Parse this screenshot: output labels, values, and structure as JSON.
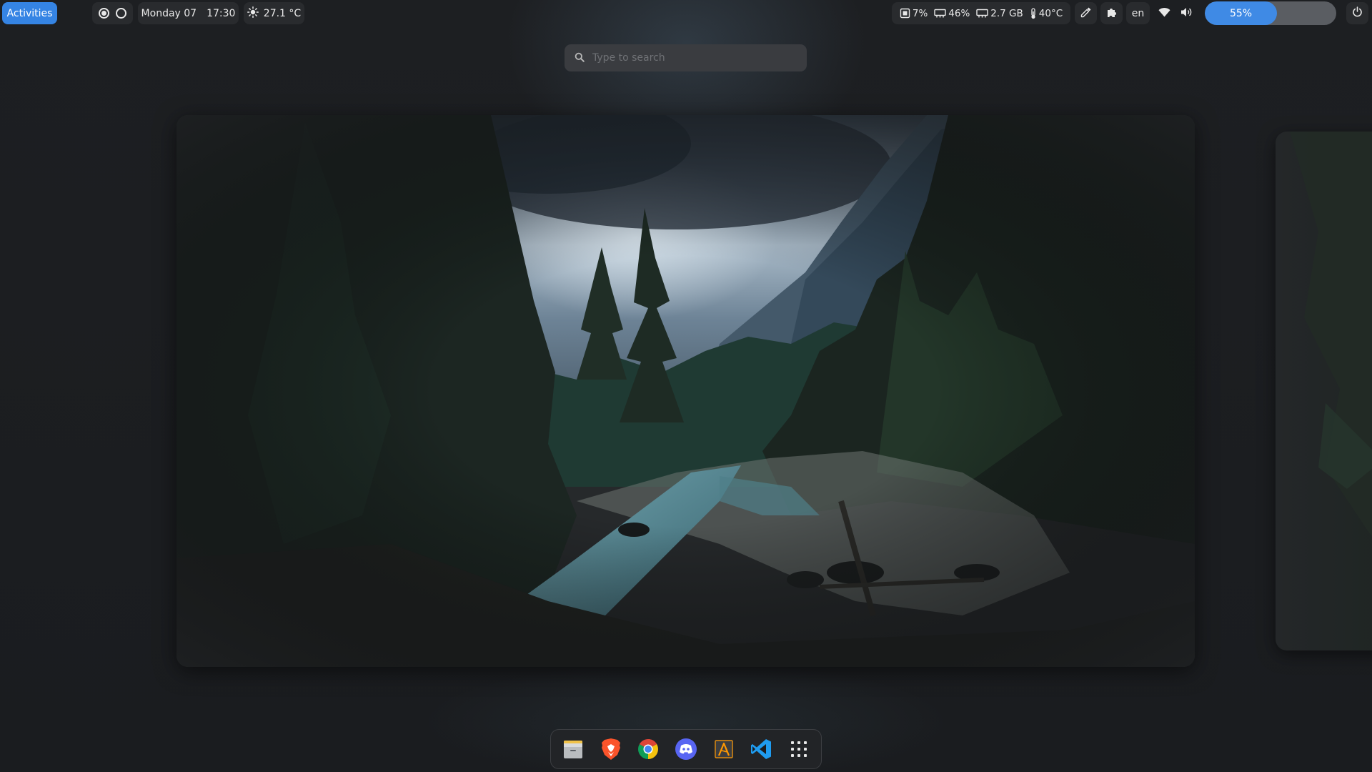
{
  "topbar": {
    "activities_label": "Activities",
    "workspaces": [
      {
        "active": true
      },
      {
        "active": false
      }
    ],
    "day_label": "Monday 07",
    "time": "17:30",
    "weather": {
      "icon": "sun-icon",
      "temperature": "27.1 °C"
    },
    "stats": {
      "cpu": {
        "icon": "cpu-icon",
        "value": "7%"
      },
      "memory": {
        "icon": "memory-icon",
        "value": "46%"
      },
      "swap": {
        "icon": "memory-icon",
        "value": "2.7 GB"
      },
      "temperature": {
        "icon": "thermometer-icon",
        "value": "40°C"
      }
    },
    "color_picker_icon": "eyedropper-icon",
    "extensions_icon": "puzzle-icon",
    "language": "en",
    "wifi_icon": "wifi-icon",
    "volume_icon": "volume-icon",
    "progress": {
      "label": "55%",
      "value": 0.55
    },
    "power_icon": "power-icon"
  },
  "search": {
    "placeholder": "Type to search",
    "value": ""
  },
  "workspaces_view": {
    "main": {
      "content": "forest-river-wallpaper"
    },
    "next": {
      "content": "forest-river-wallpaper"
    }
  },
  "dock": {
    "apps": [
      {
        "name": "files",
        "icon": "file-manager-icon"
      },
      {
        "name": "brave",
        "icon": "brave-icon"
      },
      {
        "name": "chrome",
        "icon": "chrome-icon"
      },
      {
        "name": "discord",
        "icon": "discord-icon"
      },
      {
        "name": "sublime",
        "icon": "sublime-text-icon"
      },
      {
        "name": "vscode",
        "icon": "vscode-icon"
      },
      {
        "name": "app-grid",
        "icon": "app-grid-icon"
      }
    ]
  },
  "colors": {
    "accent": "#3584e4",
    "panel_bg": "#1b1d20",
    "search_bg": "#3a3c40",
    "progress_fill": "#3f8ae5",
    "progress_track": "#5a5d62"
  }
}
